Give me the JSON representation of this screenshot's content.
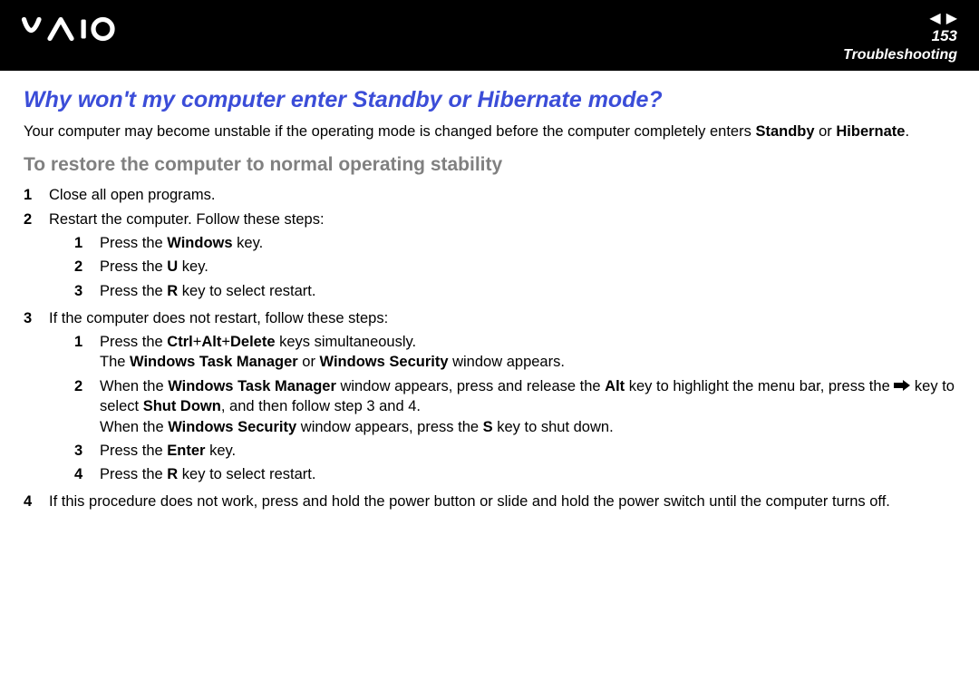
{
  "header": {
    "page_number": "153",
    "section": "Troubleshooting"
  },
  "title": "Why won't my computer enter Standby or Hibernate mode?",
  "intro": {
    "pre": "Your computer may become unstable if the operating mode is changed before the computer completely enters ",
    "bold1": "Standby",
    "mid": " or ",
    "bold2": "Hibernate",
    "post": "."
  },
  "subhead": "To restore the computer to normal operating stability",
  "steps": {
    "s1": {
      "num": "1",
      "text": "Close all open programs."
    },
    "s2": {
      "num": "2",
      "text": "Restart the computer. Follow these steps:"
    },
    "s2_1": {
      "num": "1",
      "pre": "Press the ",
      "b": "Windows",
      "post": " key."
    },
    "s2_2": {
      "num": "2",
      "pre": "Press the ",
      "b": "U",
      "post": " key."
    },
    "s2_3": {
      "num": "3",
      "pre": "Press the ",
      "b": "R",
      "post": " key to select restart."
    },
    "s3": {
      "num": "3",
      "text": "If the computer does not restart, follow these steps:"
    },
    "s3_1": {
      "num": "1",
      "l1_pre": "Press the ",
      "l1_b": "Ctrl",
      "l1_mid1": "+",
      "l1_b2": "Alt",
      "l1_mid2": "+",
      "l1_b3": "Delete",
      "l1_post": " keys simultaneously.",
      "l2_pre": "The ",
      "l2_b1": "Windows Task Manager",
      "l2_mid": " or ",
      "l2_b2": "Windows Security",
      "l2_post": " window appears."
    },
    "s3_2": {
      "num": "2",
      "l1_pre": "When the ",
      "l1_b1": "Windows Task Manager",
      "l1_mid": " window appears, press and release the ",
      "l1_b2": "Alt",
      "l1_post": " key to highlight the menu bar, press the ",
      "l2_mid": " key to select ",
      "l2_b": "Shut Down",
      "l2_post": ", and then follow step 3 and 4.",
      "l3_pre": "When the ",
      "l3_b1": "Windows Security",
      "l3_mid": " window appears, press the ",
      "l3_b2": "S",
      "l3_post": " key to shut down."
    },
    "s3_3": {
      "num": "3",
      "pre": "Press the ",
      "b": "Enter",
      "post": " key."
    },
    "s3_4": {
      "num": "4",
      "pre": "Press the ",
      "b": "R",
      "post": " key to select restart."
    },
    "s4": {
      "num": "4",
      "text": "If this procedure does not work, press and hold the power button or slide and hold the power switch until the computer turns off."
    }
  }
}
